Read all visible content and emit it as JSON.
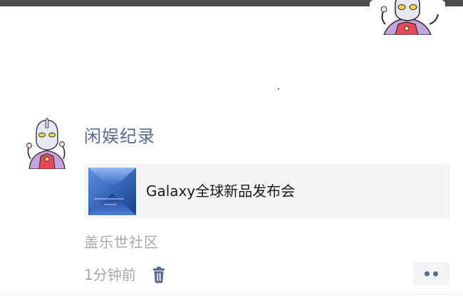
{
  "post": {
    "author": "闲娱纪录",
    "card": {
      "title": "Galaxy全球新品发布会",
      "thumbnail_icon": "galaxy-event-thumbnail"
    },
    "source": "盖乐世社区",
    "time": "1分钟前",
    "icons": {
      "delete": "trash-icon",
      "more": "more-dots-icon"
    }
  },
  "colors": {
    "author_link": "#576b95",
    "meta_text": "#a8a8a8",
    "card_background": "#f5f5f5",
    "top_bar": "#4c4c4c"
  }
}
